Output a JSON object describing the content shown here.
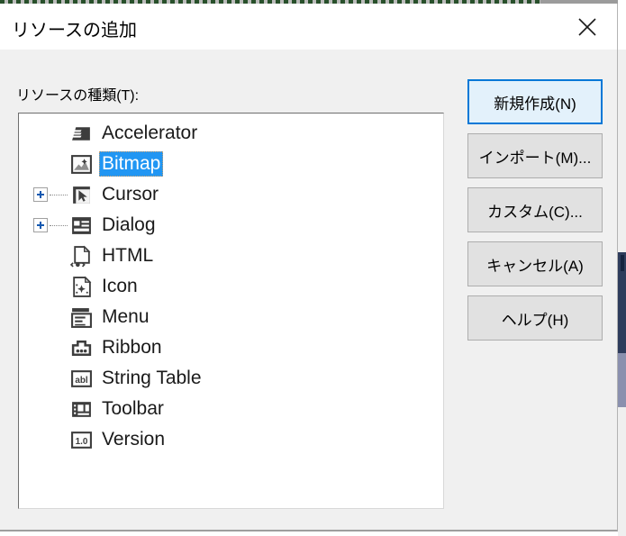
{
  "window": {
    "title": "リソースの追加",
    "close_label": "×",
    "close_icon": "close-icon"
  },
  "background": {
    "top_strip_color": "#1d4720",
    "right_edge_color": "#2e3c5c"
  },
  "body": {
    "list_label": "リソースの種類(T):",
    "selection_color": "#2196f3",
    "accent_color": "#0078d7"
  },
  "resource_tree": {
    "items": [
      {
        "label": "Accelerator",
        "icon": "accelerator-icon",
        "expandable": false,
        "selected": false
      },
      {
        "label": "Bitmap",
        "icon": "bitmap-icon",
        "expandable": false,
        "selected": true
      },
      {
        "label": "Cursor",
        "icon": "cursor-icon",
        "expandable": true,
        "selected": false
      },
      {
        "label": "Dialog",
        "icon": "dialog-icon",
        "expandable": true,
        "selected": false
      },
      {
        "label": "HTML",
        "icon": "html-icon",
        "expandable": false,
        "selected": false
      },
      {
        "label": "Icon",
        "icon": "icon-icon",
        "expandable": false,
        "selected": false
      },
      {
        "label": "Menu",
        "icon": "menu-icon",
        "expandable": false,
        "selected": false
      },
      {
        "label": "Ribbon",
        "icon": "ribbon-icon",
        "expandable": false,
        "selected": false
      },
      {
        "label": "String Table",
        "icon": "string-table-icon",
        "expandable": false,
        "selected": false
      },
      {
        "label": "Toolbar",
        "icon": "toolbar-icon",
        "expandable": false,
        "selected": false
      },
      {
        "label": "Version",
        "icon": "version-icon",
        "expandable": false,
        "selected": false
      }
    ]
  },
  "buttons": [
    {
      "label": "新規作成(N)",
      "primary": true
    },
    {
      "label": "インポート(M)...",
      "primary": false
    },
    {
      "label": "カスタム(C)...",
      "primary": false
    },
    {
      "label": "キャンセル(A)",
      "primary": false
    },
    {
      "label": "ヘルプ(H)",
      "primary": false
    }
  ]
}
